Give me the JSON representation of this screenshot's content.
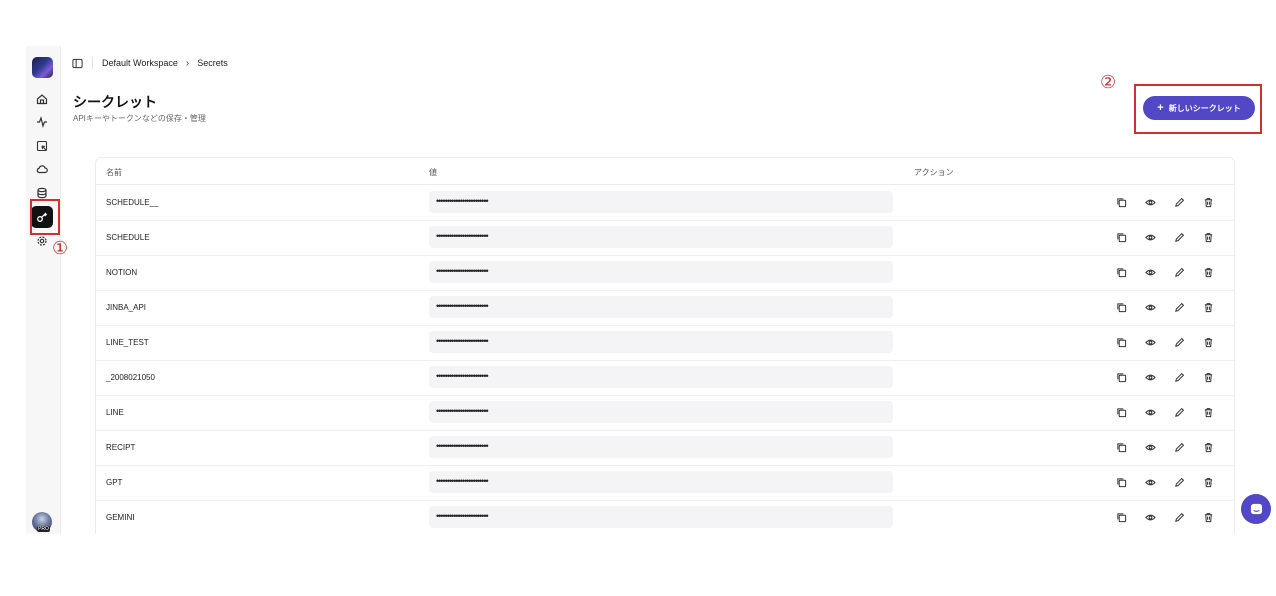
{
  "breadcrumb": {
    "workspace": "Default Workspace",
    "page": "Secrets"
  },
  "page": {
    "title": "シークレット",
    "subtitle": "APIキーやトークンなどの保存・管理"
  },
  "new_button": {
    "label": "新しいシークレット"
  },
  "table": {
    "headers": {
      "name": "名前",
      "value": "値",
      "actions": "アクション"
    },
    "masked_value": "••••••••••••••••••••••••",
    "rows": [
      {
        "name": "SCHEDULE__"
      },
      {
        "name": "SCHEDULE"
      },
      {
        "name": "NOTION"
      },
      {
        "name": "JINBA_API"
      },
      {
        "name": "LINE_TEST"
      },
      {
        "name": "_2008021050"
      },
      {
        "name": "LINE"
      },
      {
        "name": "RECIPT"
      },
      {
        "name": "GPT"
      },
      {
        "name": "GEMINI"
      }
    ]
  },
  "sidebar": {
    "icons": [
      "home-icon",
      "activity-icon",
      "task-icon",
      "cloud-icon",
      "database-icon",
      "key-icon",
      "settings-icon"
    ],
    "active": "key-icon"
  },
  "annotations": [
    "①",
    "②"
  ],
  "colors": {
    "accent": "#5147c7",
    "annotation": "#d32f2f"
  }
}
